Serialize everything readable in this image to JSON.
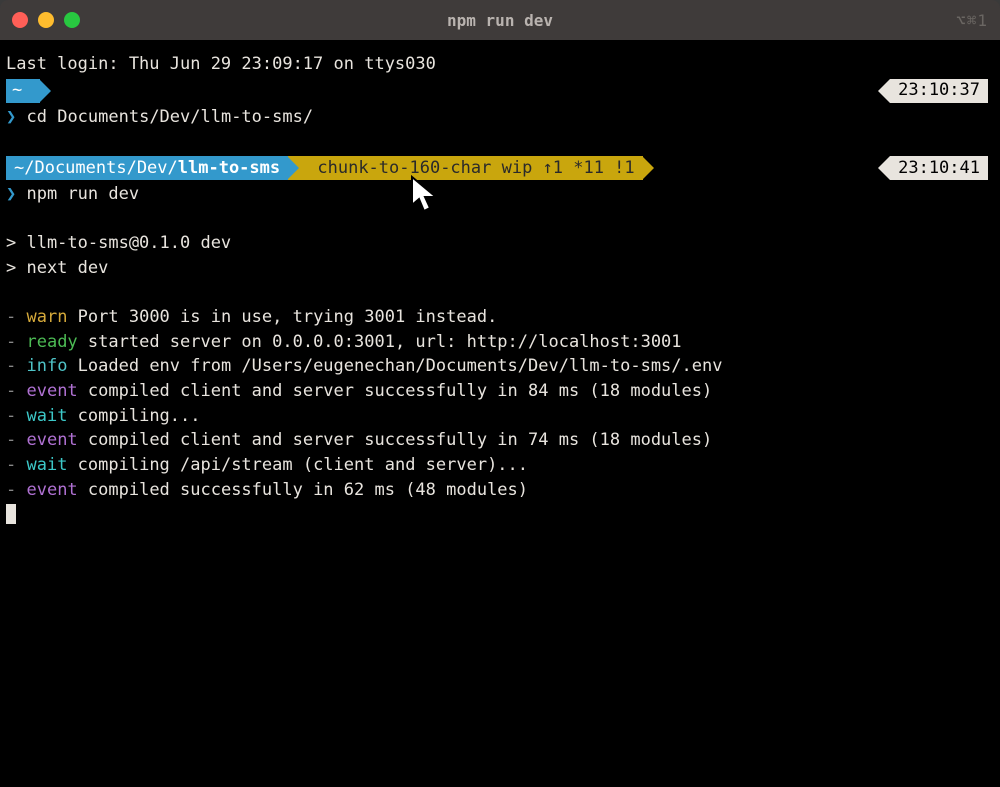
{
  "window": {
    "title": "npm run dev",
    "right_indicator": "⌥⌘1"
  },
  "login_line": "Last login: Thu Jun 29 23:09:17 on ttys030",
  "prompt1": {
    "home_glyph": "~",
    "angle": "❯",
    "command": "cd Documents/Dev/llm-to-sms/",
    "time": "23:10:37"
  },
  "prompt2": {
    "path_prefix": "~/Documents/Dev/",
    "path_bright": "llm-to-sms",
    "branch": "chunk-to-160-char wip ↑1 *11 !1",
    "angle": "❯",
    "command": "npm run dev",
    "time": "23:10:41"
  },
  "script_header": [
    "> llm-to-sms@0.1.0 dev",
    "> next dev"
  ],
  "log_lines": [
    {
      "level": "warn",
      "text": "Port 3000 is in use, trying 3001 instead."
    },
    {
      "level": "ready",
      "text": "started server on 0.0.0.0:3001, url: http://localhost:3001"
    },
    {
      "level": "info",
      "text": "Loaded env from /Users/eugenechan/Documents/Dev/llm-to-sms/.env"
    },
    {
      "level": "event",
      "text": "compiled client and server successfully in 84 ms (18 modules)"
    },
    {
      "level": "wait",
      "text": "compiling..."
    },
    {
      "level": "event",
      "text": "compiled client and server successfully in 74 ms (18 modules)"
    },
    {
      "level": "wait",
      "text": "compiling /api/stream (client and server)..."
    },
    {
      "level": "event",
      "text": "compiled successfully in 62 ms (48 modules)"
    }
  ]
}
